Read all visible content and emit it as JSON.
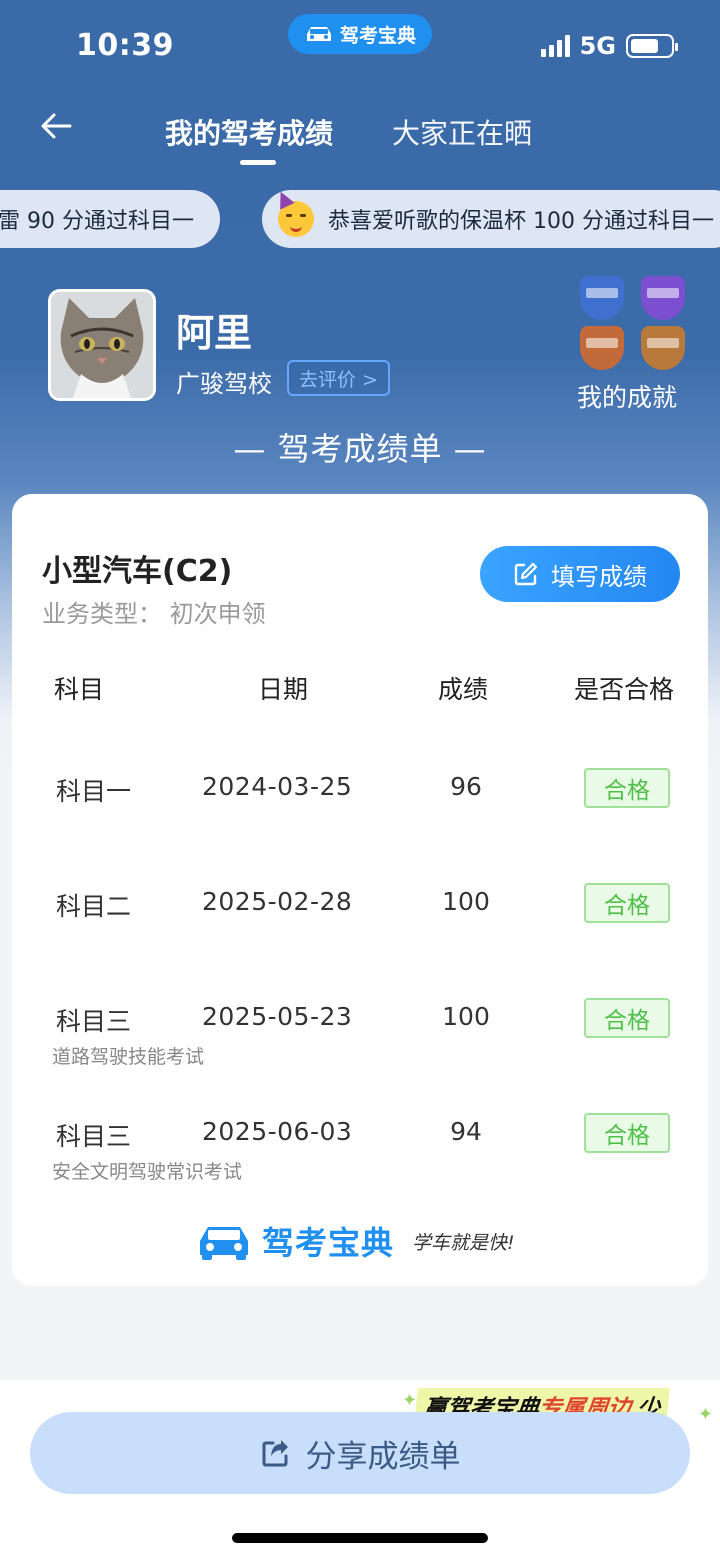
{
  "status_bar": {
    "time": "10:39",
    "network": "5G",
    "battery_fraction": 0.72
  },
  "app_badge": {
    "label": "驾考宝典"
  },
  "nav": {
    "tab_active": "我的驾考成绩",
    "tab_other": "大家正在晒"
  },
  "ticker": [
    {
      "text": "雷 90 分通过科目一"
    },
    {
      "text": "恭喜爱听歌的保温杯 100 分通过科目一"
    }
  ],
  "profile": {
    "name": "阿里",
    "school": "广骏驾校",
    "review_label": "去评价 >",
    "achievements_label": "我的成就",
    "badge_colors": [
      "#3f6fcf",
      "#7b4fcf",
      "#c26a3a",
      "#b9793a"
    ]
  },
  "report_title": "— 驾考成绩单 —",
  "card": {
    "car_type": "小型汽车(C2)",
    "business_type": "业务类型：  初次申领",
    "fill_button": "填写成绩",
    "headers": {
      "subject": "科目",
      "date": "日期",
      "score": "成绩",
      "passed": "是否合格"
    },
    "rows": [
      {
        "subject": "科目一",
        "date": "2024-03-25",
        "score": "96",
        "note": "",
        "result": "合格"
      },
      {
        "subject": "科目二",
        "date": "2025-02-28",
        "score": "100",
        "note": "",
        "result": "合格"
      },
      {
        "subject": "科目三",
        "date": "2025-05-23",
        "score": "100",
        "note": "道路驾驶技能考试",
        "result": "合格"
      },
      {
        "subject": "科目三",
        "date": "2025-06-03",
        "score": "94",
        "note": "安全文明驾驶常识考试",
        "result": "合格"
      }
    ],
    "brand": "驾考宝典",
    "slogan": "学车就是快!"
  },
  "promo": {
    "part1": "赢驾考宝典",
    "part2": "专属周边",
    "tail": "少"
  },
  "share_button": "分享成绩单",
  "colors": {
    "accent": "#1f8ff0",
    "hero": "#3a6aa8",
    "pass_green": "#4fbf4a"
  }
}
